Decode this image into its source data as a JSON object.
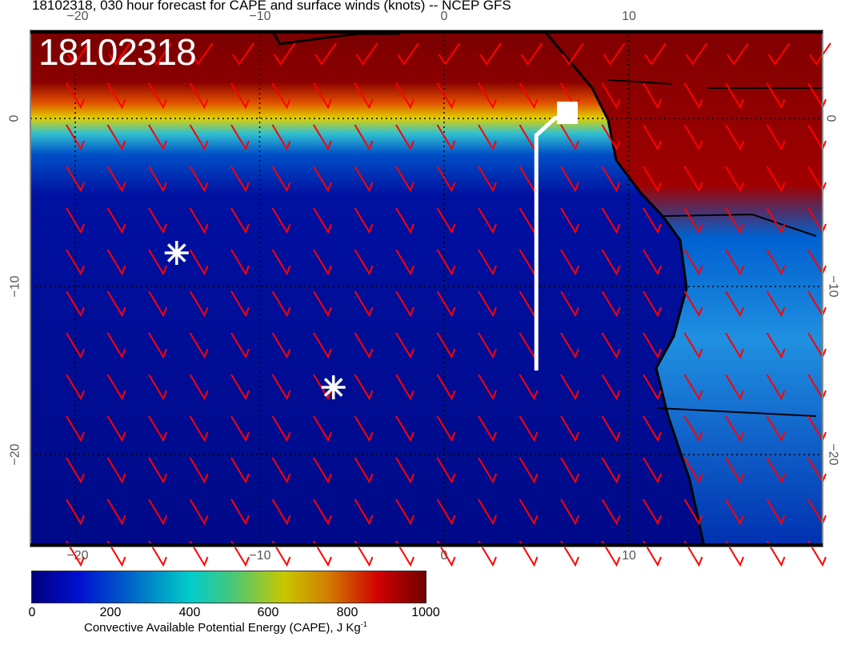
{
  "title": "18102318, 030 hour forecast for CAPE and surface winds (knots) -- NCEP GFS",
  "stamp": "18102318",
  "lon_ticks": [
    "−20",
    "−10",
    "0",
    "10"
  ],
  "lat_ticks": [
    "0",
    "−10",
    "−20"
  ],
  "colorbar": {
    "ticks": [
      "0",
      "200",
      "400",
      "600",
      "800",
      "1000"
    ],
    "label": "Convective Available Potential Energy (CAPE), J Kg",
    "label_sup": "-1",
    "range": [
      0,
      1000
    ]
  },
  "colors": {
    "ocean": "#00107f",
    "high_cape": "#7a0000",
    "barb": "#ff0000",
    "coast": "#000000",
    "track": "#ffffff"
  },
  "markers": [
    {
      "type": "asterisk",
      "lon": -14.5,
      "lat": -8
    },
    {
      "type": "asterisk",
      "lon": -6,
      "lat": -16
    }
  ],
  "track": {
    "points": [
      [
        5,
        -15
      ],
      [
        5,
        -1
      ],
      [
        6,
        0
      ],
      [
        7,
        0.3
      ]
    ]
  }
}
